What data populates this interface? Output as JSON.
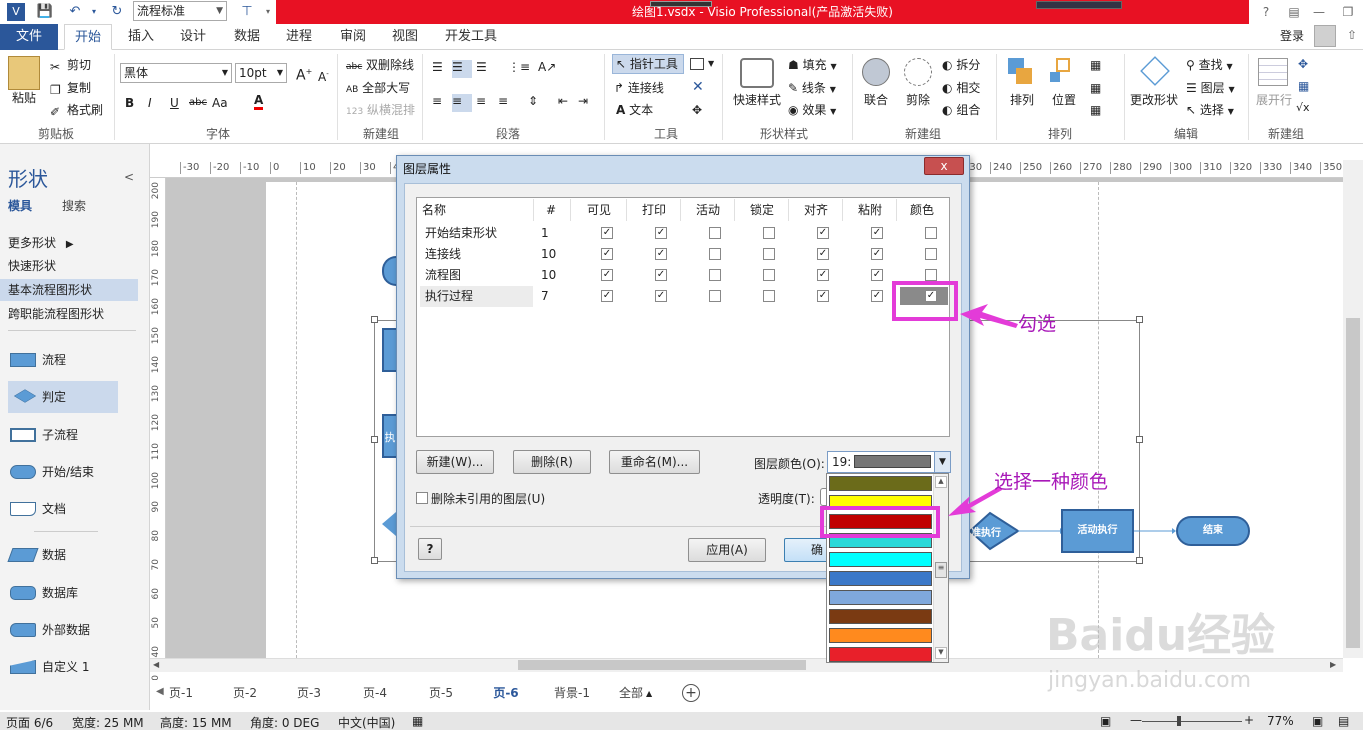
{
  "titlebar": {
    "title": "绘图1.vsdx - Visio Professional(产品激活失败)",
    "style_combo": "流程标准",
    "login": "登录"
  },
  "tabs": [
    "文件",
    "开始",
    "插入",
    "设计",
    "数据",
    "进程",
    "审阅",
    "视图",
    "开发工具"
  ],
  "ribbon": {
    "clipboard": {
      "paste": "粘贴",
      "cut": "剪切",
      "copy": "复制",
      "format_painter": "格式刷",
      "group": "剪贴板"
    },
    "font": {
      "family": "黑体",
      "size": "10pt",
      "bold": "B",
      "italic": "I",
      "underline": "U",
      "strike": "abc",
      "aa": "Aa",
      "color": "A",
      "group": "字体"
    },
    "newgroup1": {
      "strike_btn": "双删除线",
      "caps": "全部大写",
      "vertical": "纵横混排",
      "group": "新建组"
    },
    "paragraph": {
      "group": "段落"
    },
    "tools": {
      "pointer": "指针工具",
      "connector": "连接线",
      "text": "文本",
      "group": "工具"
    },
    "shape_styles": {
      "quick": "快速样式",
      "fill": "填充",
      "line": "线条",
      "effect": "效果",
      "group": "形状样式"
    },
    "newgroup2": {
      "union": "联合",
      "cut": "剪除",
      "split": "拆分",
      "intersect": "相交",
      "combine": "组合",
      "group": "新建组"
    },
    "arrange": {
      "layer": "排列",
      "position": "位置",
      "group": "排列"
    },
    "edit": {
      "change_shape": "更改形状",
      "find": "查找",
      "layers": "图层",
      "select": "选择",
      "group": "编辑"
    },
    "newgroup3": {
      "flat": "展开行",
      "group": "新建组"
    }
  },
  "shapes_panel": {
    "title": "形状",
    "tab_stencils": "模具",
    "tab_search": "搜索",
    "more": "更多形状",
    "stencils": [
      "快速形状",
      "基本流程图形状",
      "跨职能流程图形状"
    ],
    "items": [
      "流程",
      "判定",
      "子流程",
      "开始/结束",
      "文档",
      "数据",
      "数据库",
      "外部数据",
      "自定义 1"
    ]
  },
  "ruler_h": [
    "-30",
    "-20",
    "-10",
    "0",
    "10",
    "20",
    "30",
    "40",
    "50",
    "60",
    "70",
    "80",
    "90",
    "100",
    "110",
    "120",
    "130",
    "140",
    "150",
    "160",
    "170",
    "180",
    "190",
    "200",
    "210",
    "220",
    "230",
    "240",
    "250",
    "260",
    "270",
    "280",
    "290",
    "300",
    "310",
    "320",
    "330",
    "340",
    "350",
    "360"
  ],
  "ruler_v": [
    "200",
    "190",
    "180",
    "170",
    "160",
    "150",
    "140",
    "130",
    "120",
    "110",
    "100",
    "90",
    "80",
    "70",
    "60",
    "50",
    "40",
    "30"
  ],
  "dialog": {
    "title": "图层属性",
    "close": "x",
    "columns": [
      "名称",
      "#",
      "可见",
      "打印",
      "活动",
      "锁定",
      "对齐",
      "粘附",
      "颜色"
    ],
    "rows": [
      {
        "name": "开始结束形状",
        "count": "1",
        "checks": [
          true,
          true,
          false,
          false,
          true,
          true,
          false
        ]
      },
      {
        "name": "连接线",
        "count": "10",
        "checks": [
          true,
          true,
          false,
          false,
          true,
          true,
          false
        ]
      },
      {
        "name": "流程图",
        "count": "10",
        "checks": [
          true,
          true,
          false,
          false,
          true,
          true,
          false
        ]
      },
      {
        "name": "执行过程",
        "count": "7",
        "checks": [
          true,
          true,
          false,
          false,
          true,
          true,
          true
        ]
      }
    ],
    "btn_new": "新建(W)...",
    "btn_delete": "删除(R)",
    "btn_rename": "重命名(M)...",
    "layer_color_label": "图层颜色(O):",
    "layer_color_value": "19:",
    "remove_unused": "删除未引用的图层(U)",
    "transparency_label": "透明度(T):",
    "btn_apply": "应用(A)",
    "btn_ok": "确定",
    "help": "?"
  },
  "color_swatches": [
    "#6b6b1a",
    "#ffff00",
    "#c00000",
    "#2ad8d8",
    "#00ffff",
    "#3b78c8",
    "#7fa8dc",
    "#7a3a12",
    "#ff8a1e",
    "#e8202a"
  ],
  "selected_color": "#767676",
  "annotations": {
    "check": "勾选",
    "choose": "选择一种颜色"
  },
  "flowchart": {
    "decision": "准执行",
    "process": "活动执行",
    "end": "结束",
    "left_box": "执"
  },
  "page_tabs": [
    "页-1",
    "页-2",
    "页-3",
    "页-4",
    "页-5",
    "页-6",
    "背景-1",
    "全部"
  ],
  "status": {
    "page": "页面 6/6",
    "width": "宽度: 25 MM",
    "height": "高度: 15 MM",
    "angle": "角度: 0 DEG",
    "lang": "中文(中国)",
    "zoom": "77%"
  },
  "watermark": {
    "brand": "Baidu经验",
    "url": "jingyan.baidu.com"
  }
}
